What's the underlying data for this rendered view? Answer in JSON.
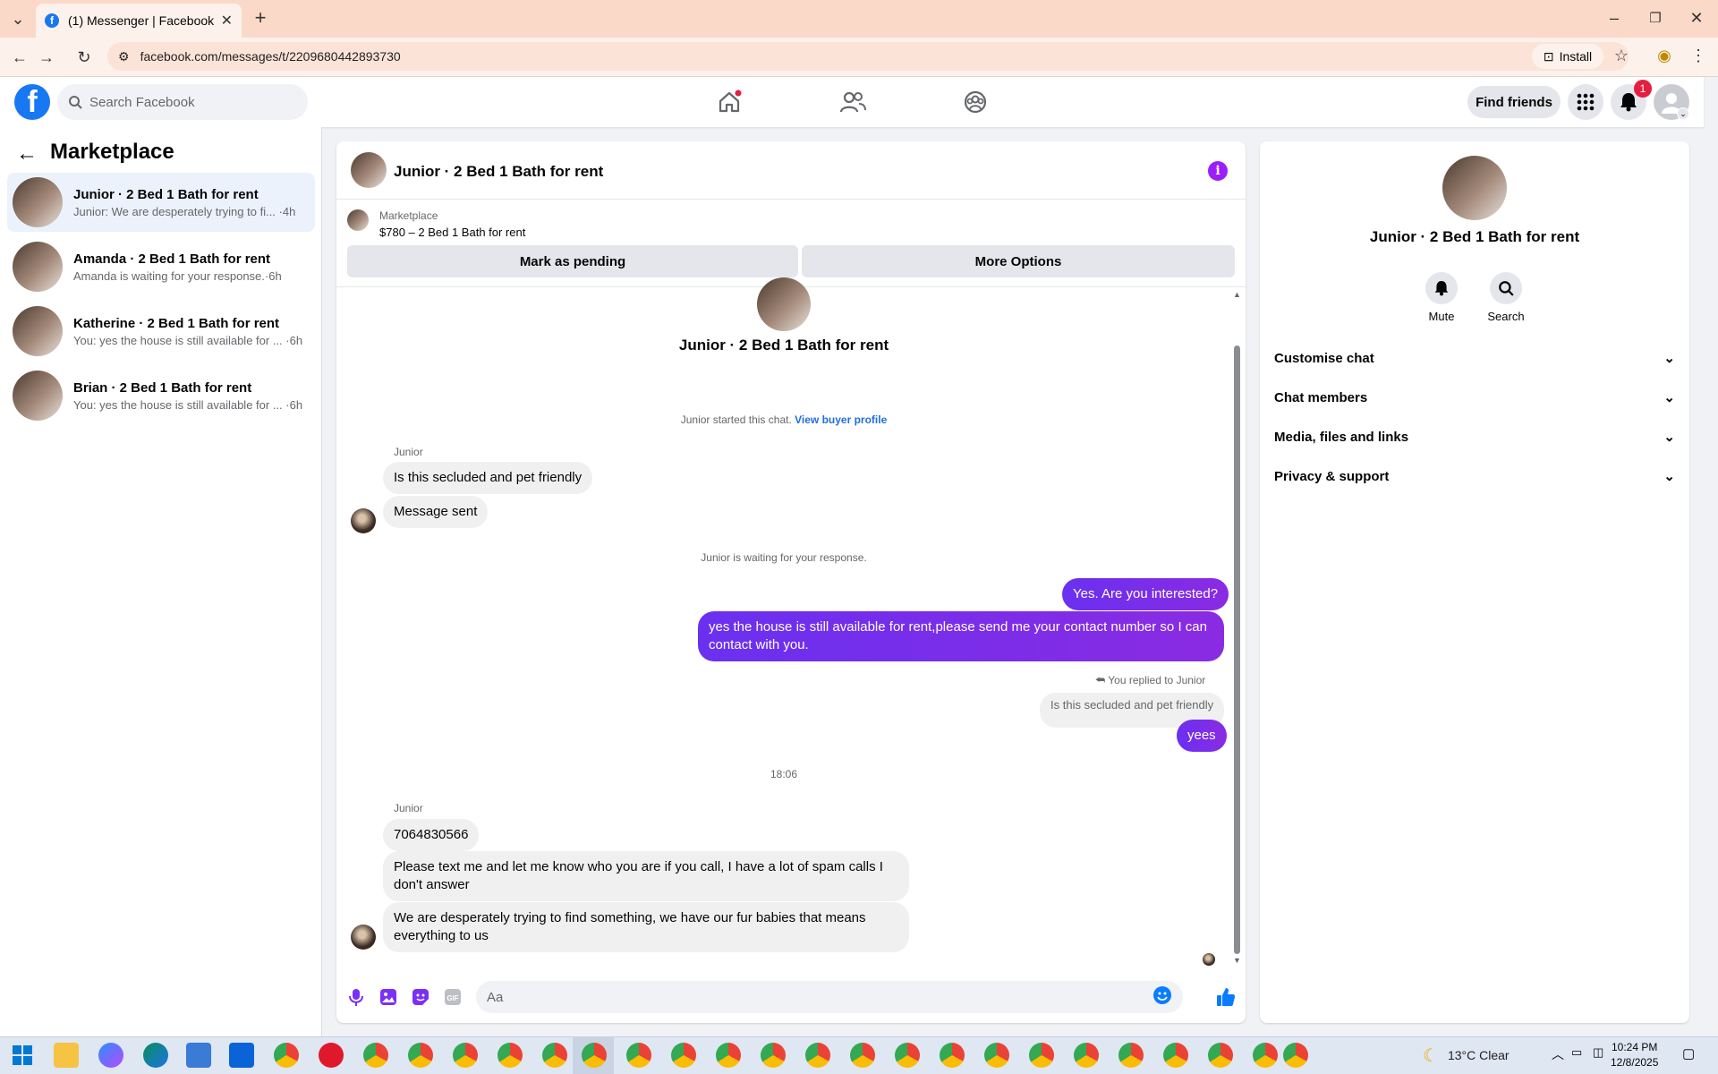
{
  "browser": {
    "tab_title": "(1) Messenger | Facebook",
    "url": "facebook.com/messages/t/2209680442893730",
    "install_label": "Install"
  },
  "header": {
    "search_placeholder": "Search Facebook",
    "find_friends": "Find friends",
    "notification_count": "1"
  },
  "sidebar": {
    "title": "Marketplace",
    "conversations": [
      {
        "name": "Junior · 2 Bed 1 Bath for rent",
        "preview": "Junior: We are desperately trying to fi... ·4h",
        "active": true
      },
      {
        "name": "Amanda · 2 Bed 1 Bath for rent",
        "preview": "Amanda is waiting for your response.·6h",
        "active": false
      },
      {
        "name": "Katherine · 2 Bed 1 Bath for rent",
        "preview": "You: yes the house is still available for ... ·6h",
        "active": false
      },
      {
        "name": "Brian · 2 Bed 1 Bath for rent",
        "preview": "You: yes the house is still available for ... ·6h",
        "active": false
      }
    ]
  },
  "chat": {
    "title": "Junior · 2 Bed 1 Bath for rent",
    "listing_label": "Marketplace",
    "listing_price": "$780 – 2 Bed 1 Bath for rent",
    "mark_pending": "Mark as pending",
    "more_options": "More Options",
    "intro_title": "Junior · 2 Bed 1 Bath for rent",
    "started_text": "Junior started this chat.",
    "view_buyer_profile": "View buyer profile",
    "messages": {
      "sender_1": "Junior",
      "in_1": "Is this secluded and pet friendly",
      "in_2": "Message sent",
      "waiting": "Junior is waiting for your response.",
      "out_1": "Yes. Are you interested?",
      "out_2_line1": "yes the house is still available for rent,please send me your contact number so I can",
      "out_2_line2": "contact with you.",
      "replied_to": "You replied to Junior",
      "quoted": "Is this secluded and pet friendly",
      "out_3": "yees",
      "time": "18:06",
      "sender_2": "Junior",
      "in_3": "7064830566",
      "in_4_line1": "Please text me and let me know who you are if you call, I have a lot of spam calls I",
      "in_4_line2": "don't answer",
      "in_5_line1": "We are desperately trying to find something, we have our fur babies that means",
      "in_5_line2": "everything to us"
    },
    "composer_placeholder": "Aa",
    "accent": "#7b2ff7"
  },
  "right_panel": {
    "title": "Junior · 2 Bed 1 Bath for rent",
    "mute": "Mute",
    "search": "Search",
    "sections": [
      "Customise chat",
      "Chat members",
      "Media, files and links",
      "Privacy & support"
    ]
  },
  "taskbar": {
    "weather": "13°C  Clear",
    "time": "10:24 PM",
    "date": "12/8/2025"
  }
}
